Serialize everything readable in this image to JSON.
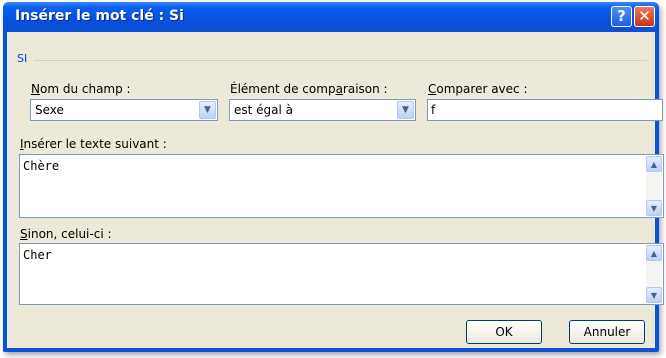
{
  "window": {
    "title": "Insérer le mot clé : Si",
    "help_glyph": "?",
    "close_glyph": "✕"
  },
  "group": {
    "label": "SI"
  },
  "fields": {
    "field_name": {
      "label_key": "N",
      "label_rest": "om du champ :",
      "value": "Sexe"
    },
    "comparison": {
      "label_pre": "Élément de comp",
      "label_key": "a",
      "label_post": "raison :",
      "value": "est égal à"
    },
    "compare_with": {
      "label_key": "C",
      "label_rest": "omparer avec :",
      "value": "f"
    }
  },
  "insert_text": {
    "label_key": "I",
    "label_rest": "nsérer le texte suivant :",
    "value": "Chère"
  },
  "otherwise": {
    "label_key": "S",
    "label_rest": "inon, celui-ci :",
    "value": "Cher"
  },
  "buttons": {
    "ok": "OK",
    "cancel": "Annuler"
  },
  "icons": {
    "dropdown": "chevron-down-icon",
    "scroll_up": "chevron-up-icon",
    "scroll_down": "chevron-down-icon"
  },
  "colors": {
    "title_bar": "#0651de",
    "dialog_bg": "#ece9d8",
    "group_label": "#0046d5"
  }
}
